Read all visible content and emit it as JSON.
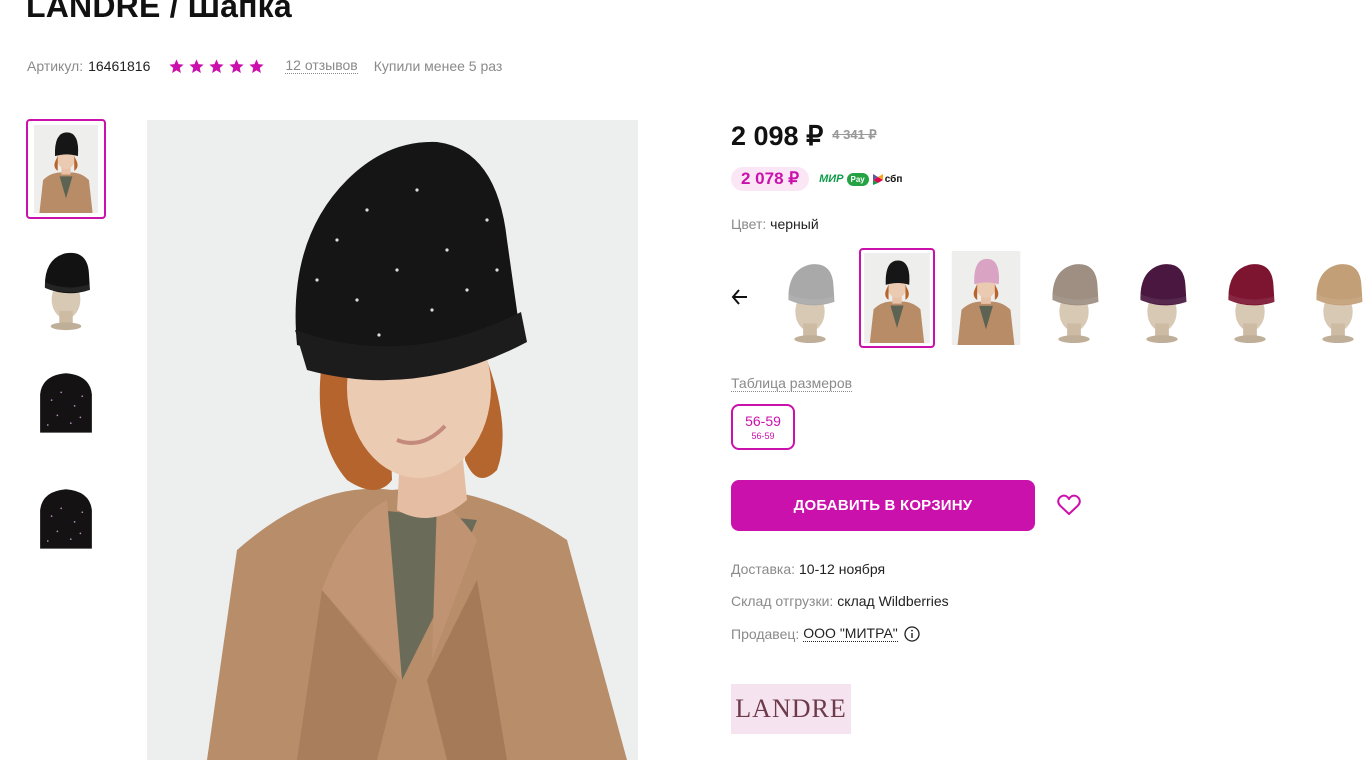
{
  "product": {
    "title": "LANDRE / Шапка",
    "article_label": "Артикул:",
    "article_value": "16461816",
    "rating_stars": 5,
    "reviews": "12 отзывов",
    "bought": "Купили менее 5 раз"
  },
  "pricing": {
    "price": "2 098 ₽",
    "old_price": "4 341 ₽",
    "card_price": "2 078 ₽",
    "payment_icons": [
      "mir-logo-icon",
      "wallet-pay-icon",
      "sbp-logo-icon"
    ],
    "mir_label": "МИР",
    "pay_label": "Pay",
    "sbp_label": "сбп"
  },
  "color": {
    "label": "Цвет:",
    "value": "черный",
    "swatches": [
      "grey",
      "black",
      "pink",
      "beige-grey",
      "purple",
      "burgundy",
      "camel"
    ]
  },
  "sizes": {
    "table_link": "Таблица размеров",
    "options": [
      {
        "label": "56-59",
        "sub": "56-59"
      }
    ]
  },
  "actions": {
    "add_to_cart": "ДОБАВИТЬ В КОРЗИНУ"
  },
  "delivery": {
    "delivery_label": "Доставка:",
    "delivery_value": "10-12 ноября",
    "warehouse_label": "Склад отгрузки:",
    "warehouse_value": "склад Wildberries",
    "seller_label": "Продавец:",
    "seller_value": "ООО \"МИТРА\""
  },
  "brand": {
    "logo_text": "LANDRE"
  },
  "colors": {
    "accent": "#cb11ab",
    "accent_light": "#fbe6f6",
    "muted_text": "#8a8a8a",
    "brand_bg": "#f5e4ef"
  }
}
